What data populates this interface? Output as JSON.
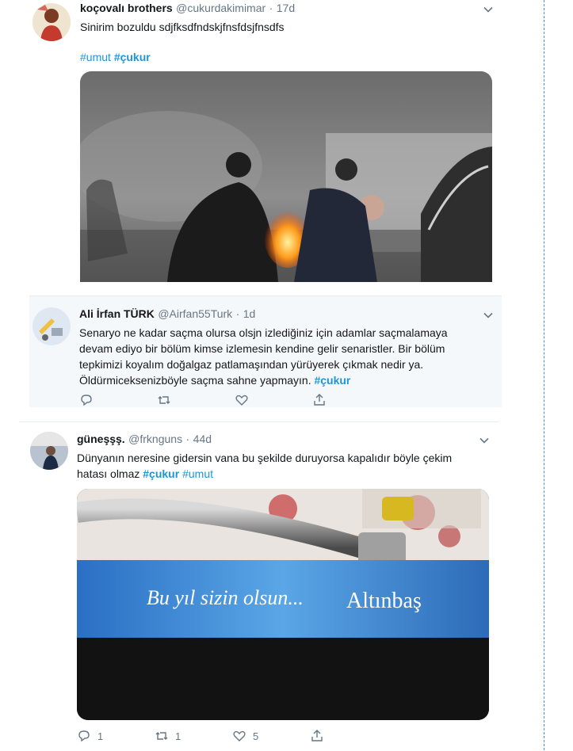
{
  "tweets": [
    {
      "name": "koçovalı brothers",
      "handle": "@cukurdakimimar",
      "sep": "·",
      "time": "17d",
      "text": "Sinirim bozuldu sdjfksdfndskjfnsfdsjfnsdfs",
      "hashtags": [
        "#umut",
        "#çukur"
      ],
      "avatar_icon": "profile-avatar"
    },
    {
      "name": "Ali İrfan TÜRK",
      "handle": "@Airfan55Turk",
      "sep": "·",
      "time": "1d",
      "lines": [
        "Senaryo ne kadar saçma olursa olsjn izlediğiniz için adamlar saçmalamaya",
        "devam ediyo bir bölüm kimse izlemesin kendine gelir senaristler. Bir bölüm",
        "tepkimizi koyalım doğalgaz patlamaşından yürüyerek çıkmak nedir ya.",
        "Öldürmiceksenizböyle saçma sahne yapmayın."
      ],
      "hashtag": "#çukur"
    },
    {
      "name": "güneşşş.",
      "handle": "@frknguns",
      "sep": "·",
      "time": "44d",
      "line1": "Dünyanın neresine gidersin vana bu şekilde duruyorsa kapalıdır böyle çekim",
      "line2": "hatası olmaz",
      "hashtags": [
        "#çukur",
        "#umut"
      ],
      "reply_count": "1",
      "retweet_count": "1",
      "like_count": "5",
      "banner_text1": "Bu yıl sizin olsun...",
      "banner_text2": "Altınbaş"
    }
  ],
  "colors": {
    "link": "#1b95e0",
    "muted": "#657786",
    "text": "#14171a",
    "alt_bg": "#f5f8fa"
  },
  "icons": [
    "chevron-down-icon",
    "reply-icon",
    "retweet-icon",
    "like-icon",
    "share-icon"
  ]
}
